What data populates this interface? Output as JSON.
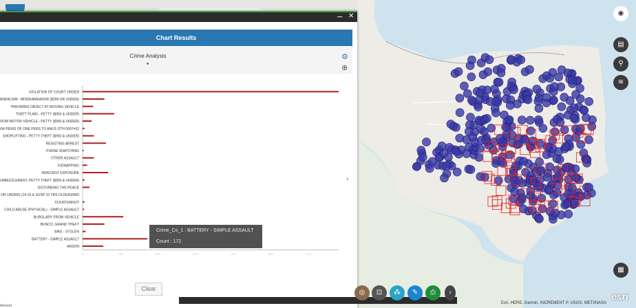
{
  "window": {
    "minimize_label": "–",
    "close_label": "✕"
  },
  "chart_results": {
    "header": "Chart Results",
    "chart_title": "Crime Analysis",
    "clear_label": "Clear"
  },
  "tooltip": {
    "line1": "Crime_Co_1 : BATTERY - SIMPLE ASSAULT",
    "line2": "Count : 172"
  },
  "map": {
    "attribution": "Esri, HERE, Garmin, INCREMENT P, USGS, METI/NASA",
    "logo": "esri",
    "scale_text": "Almond"
  },
  "right_tools": [
    "eye-icon",
    "print-icon",
    "filter-icon",
    "layers-icon",
    "table-icon"
  ],
  "bottom_tools": [
    "analysis-icon",
    "select-icon",
    "network-icon",
    "edit-icon",
    "print-icon"
  ],
  "chart_data": {
    "type": "bar",
    "orientation": "horizontal",
    "categories": [
      "VIOLATION OF COURT ORDER",
      "VANDALISM - MISDEAMEANOR ($399 OR UNDER)",
      "THROWING OBJECT AT MOVING VEHICLE",
      "THEFT PLAIN - PETTY ($950 & UNDER)",
      "FROM MOTOR VEHICLE - PETTY ($950 & UNDER)",
      "B/W PENIS OF ONE PERS TO ANUS OTH 0007=02",
      "SHOPLIFTING - PETTY THEFT ($950 & UNDER)",
      "RESISTING ARREST",
      "PURSE SNATCHING",
      "OTHER ASSAULT",
      "KIDNAPPING",
      "INDECENT EXPOSURE",
      "EMBEZZLEMENT, PETTY THEFT ($950 & UNDER)",
      "DISTURBING THE PEACE",
      "0 OR UNDER) (14-15 & SUSP 10 YRS OLDER)0060",
      "COUNTERFEIT",
      "CHILD ABUSE (PHYSICAL) - SIMPLE ASSAULT",
      "BURGLARY FROM VEHICLE",
      "BUNCO, GRAND THEFT",
      "BIKE - STOLEN",
      "BATTERY - SIMPLE ASSAULT",
      "ARSON"
    ],
    "values": [
      680,
      58,
      28,
      84,
      24,
      5,
      30,
      62,
      3,
      30,
      12,
      68,
      5,
      18,
      0,
      5,
      4,
      108,
      58,
      8,
      172,
      55
    ],
    "xlim": [
      0,
      680
    ],
    "xticks": [
      0,
      100,
      200,
      300,
      400,
      500,
      600
    ],
    "bar_color": "#b01c1c",
    "grid": false
  }
}
